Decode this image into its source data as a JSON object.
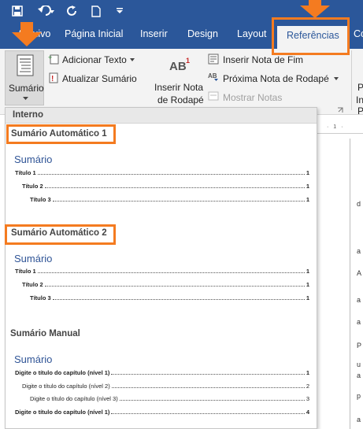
{
  "quick_access": {
    "save_icon": "save-icon",
    "undo_icon": "undo-icon",
    "redo_icon": "redo-icon",
    "new_doc_icon": "new-document-icon",
    "customize_icon": "customize-qat-icon"
  },
  "tabs": [
    {
      "label": "Arquivo"
    },
    {
      "label": "Página Inicial"
    },
    {
      "label": "Inserir"
    },
    {
      "label": "Design"
    },
    {
      "label": "Layout"
    },
    {
      "label": "Referências",
      "active": true
    },
    {
      "label": "Cor"
    }
  ],
  "ribbon": {
    "sumario_label": "Sumário",
    "adicionar_texto": "Adicionar Texto",
    "atualizar_sumario": "Atualizar Sumário",
    "inserir_nota_label_1": "Inserir Nota",
    "inserir_nota_label_2": "de Rodapé",
    "ab_glyph": "AB",
    "ab_superscript": "1",
    "inserir_nota_fim": "Inserir Nota de Fim",
    "proxima_nota": "Próxima Nota de Rodapé",
    "mostrar_notas": "Mostrar Notas",
    "right_clip_1": "P",
    "right_clip_2": "In",
    "right_clip_3": "P"
  },
  "gallery": {
    "header": "Interno",
    "sections": [
      {
        "name": "Sumário Automático 1",
        "toc_title": "Sumário",
        "lines": [
          {
            "label": "Título 1",
            "page": "1",
            "level": 1
          },
          {
            "label": "Título 2",
            "page": "1",
            "level": 2
          },
          {
            "label": "Título 3",
            "page": "1",
            "level": 3
          }
        ]
      },
      {
        "name": "Sumário Automático 2",
        "toc_title": "Sumário",
        "lines": [
          {
            "label": "Título 1",
            "page": "1",
            "level": 1
          },
          {
            "label": "Título 2",
            "page": "1",
            "level": 2
          },
          {
            "label": "Título 3",
            "page": "1",
            "level": 3
          }
        ]
      },
      {
        "name": "Sumário Manual",
        "toc_title": "Sumário",
        "lines": [
          {
            "label": "Digite o título do capítulo (nível 1)",
            "page": "1",
            "level": 1
          },
          {
            "label": "Digite o título do capítulo (nível 2)",
            "page": "2",
            "level": 2
          },
          {
            "label": "Digite o título do capítulo (nível 3)",
            "page": "3",
            "level": 3
          },
          {
            "label": "Digite o título do capítulo (nível 1)",
            "page": "4",
            "level": 1
          }
        ]
      }
    ]
  },
  "document": {
    "ruler_text": "· 1 ·",
    "margin_letters": [
      "d",
      "a",
      "A",
      "a",
      "a",
      "P",
      "u",
      "a",
      "p",
      "a"
    ]
  },
  "colors": {
    "brand": "#2b579a",
    "highlight": "#f47b20",
    "toc_title": "#2f5496"
  }
}
